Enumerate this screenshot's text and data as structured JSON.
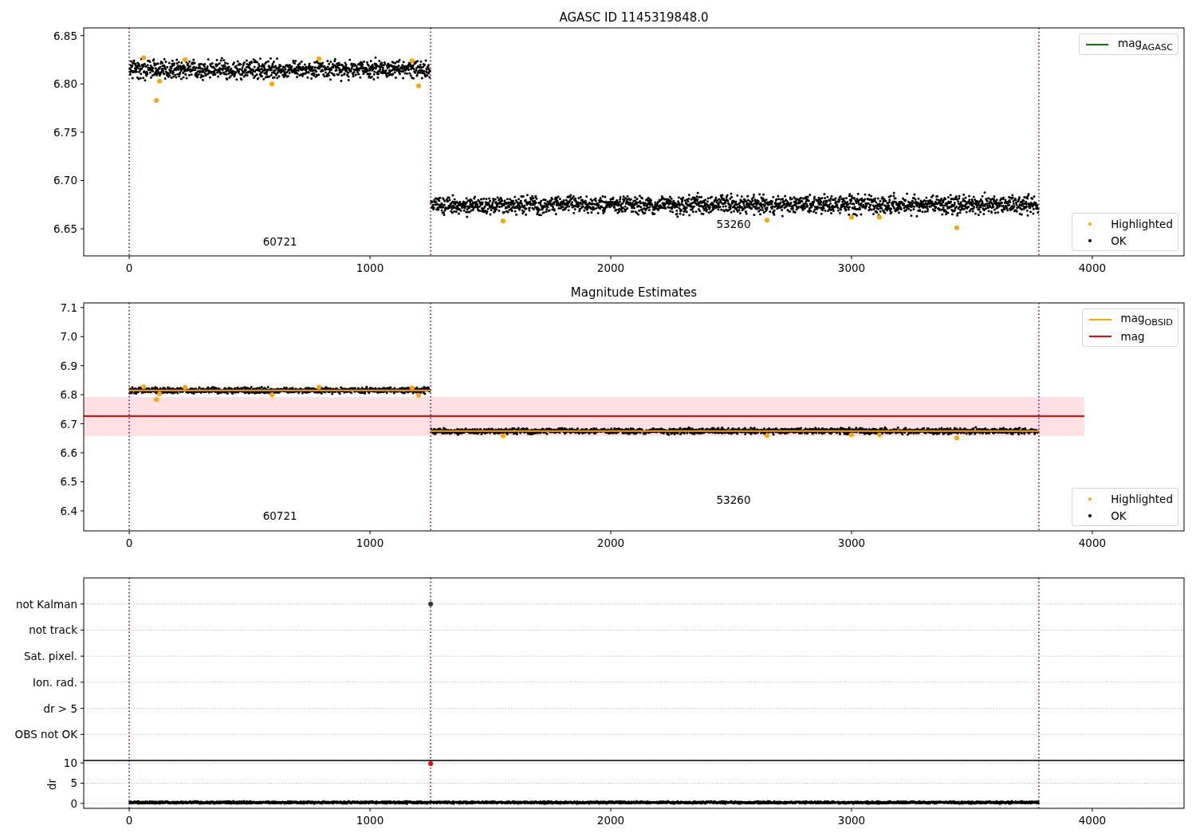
{
  "panels": [
    {
      "kind": "magnitude",
      "title": "AGASC ID 1145319848.0",
      "chart_data": {
        "type": "scatter",
        "xlim": [
          -189,
          4381
        ],
        "ylim": [
          6.622,
          6.858
        ],
        "xticks": [
          0,
          1000,
          2000,
          3000,
          4000
        ],
        "yticks": [
          {
            "value": 6.65,
            "label": "6.65"
          },
          {
            "value": 6.7,
            "label": "6.70"
          },
          {
            "value": 6.75,
            "label": "6.75"
          },
          {
            "value": 6.8,
            "label": "6.80"
          },
          {
            "value": 6.85,
            "label": "6.85"
          }
        ],
        "series": [
          {
            "color": "#ffa500",
            "x": [
              60,
              113,
              126,
              232,
              593,
              788,
              1175,
              1202,
              1553,
              2649,
              3000,
              3116,
              3437
            ],
            "values": [
              6.827,
              6.783,
              6.803,
              6.825,
              6.8,
              6.826,
              6.824,
              6.798,
              6.658,
              6.659,
              6.662,
              6.662,
              6.651
            ]
          }
        ],
        "ref_lines": [
          {
            "axis": "x",
            "value": 0,
            "color": "#800080"
          },
          {
            "axis": "x",
            "value": 1252,
            "color": "#800080"
          },
          {
            "axis": "x",
            "value": 3778,
            "color": "#800080"
          }
        ],
        "annotations": [
          {
            "text": "60721"
          },
          {
            "text": "53260"
          }
        ]
      },
      "legends": [
        {
          "entries": [
            {
              "label": "mag$_{AGASC}$",
              "kind": "line",
              "color": "#008000"
            }
          ]
        },
        {
          "entries": [
            {
              "label": "Highlighted",
              "kind": "dot",
              "color": "#ffa500"
            },
            {
              "label": "OK",
              "kind": "dot",
              "color": "#000000"
            }
          ]
        }
      ]
    },
    {
      "kind": "magnitude",
      "title": "Magnitude Estimates",
      "chart_data": {
        "type": "scatter",
        "xlim": [
          -189,
          4381
        ],
        "ylim": [
          6.331,
          7.116
        ],
        "xticks": [
          0,
          1000,
          2000,
          3000,
          4000
        ],
        "yticks": [
          {
            "value": 6.4,
            "label": "6.4"
          },
          {
            "value": 6.5,
            "label": "6.5"
          },
          {
            "value": 6.6,
            "label": "6.6"
          },
          {
            "value": 6.7,
            "label": "6.7"
          },
          {
            "value": 6.8,
            "label": "6.8"
          },
          {
            "value": 6.9,
            "label": "6.9"
          },
          {
            "value": 7.0,
            "label": "7.0"
          },
          {
            "value": 7.1,
            "label": "7.1"
          }
        ],
        "series": [
          {
            "color": "#ffa500",
            "x": [
              60,
              113,
              126,
              232,
              593,
              788,
              1175,
              1202,
              1553,
              2649,
              3000,
              3116,
              3437
            ],
            "values": [
              6.827,
              6.783,
              6.803,
              6.825,
              6.8,
              6.826,
              6.824,
              6.798,
              6.658,
              6.659,
              6.662,
              6.662,
              6.651
            ]
          },
          {
            "type": "line",
            "color": "#ffa500",
            "x": [
              0,
              1252
            ],
            "values": [
              6.815,
              6.815
            ]
          },
          {
            "type": "line",
            "color": "#ffa500",
            "x": [
              1252,
              3778
            ],
            "values": [
              6.675,
              6.675
            ]
          },
          {
            "type": "line",
            "color": "#ff0000",
            "x": [
              -189,
              3967
            ],
            "values": [
              6.726,
              6.726
            ]
          }
        ],
        "bands": [
          {
            "axis": "y",
            "from": 6.658,
            "to": 6.792,
            "color": "#ffe0e3"
          }
        ],
        "ref_lines": [
          {
            "axis": "x",
            "value": 0,
            "color": "#800080"
          },
          {
            "axis": "x",
            "value": 1252,
            "color": "#800080"
          },
          {
            "axis": "x",
            "value": 3778,
            "color": "#800080"
          }
        ],
        "annotations": [
          {
            "text": "60721"
          },
          {
            "text": "53260"
          }
        ]
      },
      "legends": [
        {
          "entries": [
            {
              "label": "mag$_{OBSID}$",
              "kind": "line",
              "color": "#ffa500"
            },
            {
              "label": "mag",
              "kind": "line",
              "color": "#ff0000"
            }
          ]
        },
        {
          "entries": [
            {
              "label": "Highlighted",
              "kind": "dot",
              "color": "#ffa500"
            },
            {
              "label": "OK",
              "kind": "dot",
              "color": "#000000"
            }
          ]
        }
      ]
    },
    {
      "kind": "flags",
      "chart_data": {
        "type": "scatter",
        "orientation": "horizontal",
        "xlim": [
          -189,
          4381
        ],
        "grid": true,
        "categories": [
          "not Kalman",
          "not track",
          "Sat. pixel.",
          "Ion. rad.",
          "dr > 5",
          "OBS not OK"
        ],
        "series": [
          {
            "color": "#333333",
            "values": [
              1252,
              null,
              null,
              null,
              null,
              null
            ]
          }
        ],
        "ref_lines": [
          {
            "axis": "x",
            "value": 0,
            "color": "#800080"
          },
          {
            "axis": "x",
            "value": 1252,
            "color": "#800080"
          },
          {
            "axis": "x",
            "value": 3778,
            "color": "#800080"
          }
        ]
      },
      "dr": {
        "chart_data": {
          "type": "scatter",
          "ylabel": "dr",
          "xlim": [
            -189,
            4381
          ],
          "ylim": [
            -1.2,
            10.6
          ],
          "grid": true,
          "xticks": [
            0,
            1000,
            2000,
            3000,
            4000
          ],
          "yticks": [
            {
              "value": 0,
              "label": "0"
            },
            {
              "value": 5,
              "label": "5"
            },
            {
              "value": 10,
              "label": "10"
            }
          ],
          "series": [
            {
              "color": "#ff0000",
              "x": [
                1252
              ],
              "values": [
                9.8
              ]
            }
          ],
          "ref_lines": [
            {
              "axis": "x",
              "value": 0,
              "color": "#800080"
            },
            {
              "axis": "x",
              "value": 1252,
              "color": "#800080"
            },
            {
              "axis": "x",
              "value": 3778,
              "color": "#800080"
            }
          ]
        }
      }
    }
  ]
}
